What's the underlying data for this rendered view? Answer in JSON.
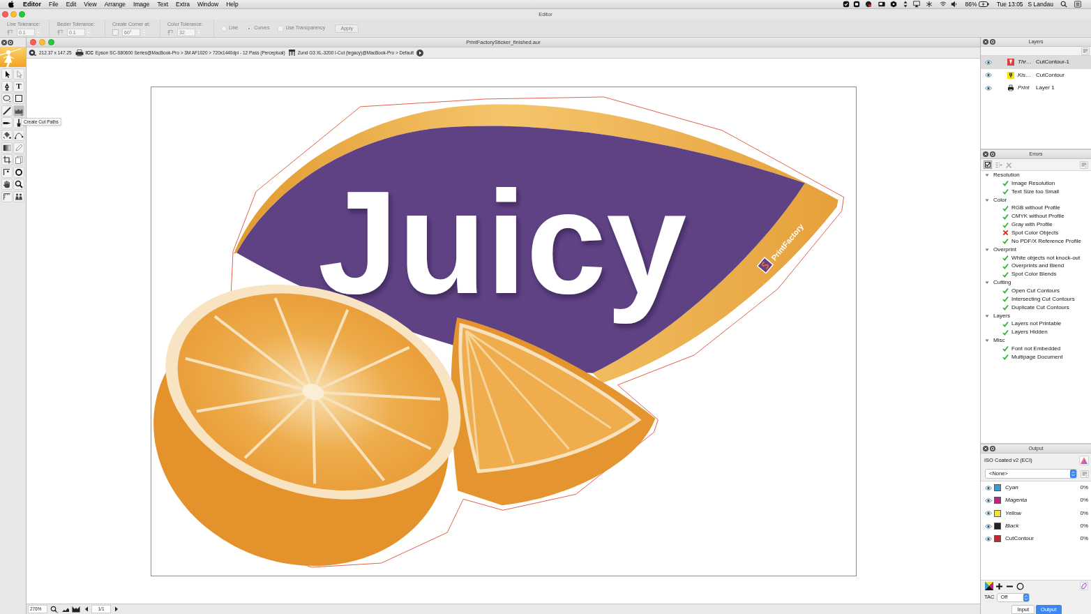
{
  "menubar": {
    "app": "Editor",
    "menus": [
      "File",
      "Edit",
      "View",
      "Arrange",
      "Image",
      "Text",
      "Extra",
      "Window",
      "Help"
    ],
    "battery": "86%",
    "clock": "Tue 13:05",
    "user": "S Landau"
  },
  "window": {
    "title": "Editor"
  },
  "toolbar": {
    "disabled": true,
    "fields": [
      {
        "label": "Line Tolerance:",
        "value": "0.1",
        "kind": "tolerance"
      },
      {
        "label": "Bezier Tolerance:",
        "value": "0.1",
        "kind": "tolerance"
      },
      {
        "label": "Create Corner at:",
        "value": "60°",
        "kind": "corner"
      },
      {
        "label": "Color Tolerance:",
        "value": "32",
        "kind": "tolerance"
      }
    ],
    "radios": [
      {
        "label": "Line",
        "selected": false
      },
      {
        "label": "Curves",
        "selected": true
      }
    ],
    "checkbox": {
      "label": "Use Trancparency",
      "checked": false
    },
    "apply": "Apply"
  },
  "toolbox": {
    "tools": [
      {
        "kind": "select",
        "selected": false
      },
      {
        "kind": "direct",
        "selected": false
      },
      {
        "kind": "pen",
        "selected": false
      },
      {
        "kind": "text",
        "glyph": "T",
        "selected": false
      },
      {
        "kind": "ellipse",
        "selected": false
      },
      {
        "kind": "rectangle",
        "selected": false
      },
      {
        "kind": "line",
        "selected": false
      },
      {
        "kind": "cutpaths",
        "selected": true
      },
      {
        "kind": "knife",
        "selected": false
      },
      {
        "kind": "brush",
        "selected": false
      },
      {
        "kind": "bucket",
        "selected": false
      },
      {
        "kind": "curve",
        "selected": false
      },
      {
        "kind": "gradient",
        "selected": false
      },
      {
        "kind": "pencil",
        "selected": false
      },
      {
        "kind": "crop",
        "selected": false
      },
      {
        "kind": "pages",
        "selected": false
      },
      {
        "kind": "corner",
        "selected": false
      },
      {
        "kind": "target",
        "selected": false
      },
      {
        "kind": "hand",
        "selected": false
      },
      {
        "kind": "zoom",
        "selected": false
      },
      {
        "kind": "ruler",
        "selected": false
      },
      {
        "kind": "figures",
        "selected": false
      }
    ],
    "tooltip": "Create Cut Paths"
  },
  "document": {
    "title": "PrintFactorySticker_finished.aur",
    "size": "212.37 x 147.25",
    "icc": "ICC",
    "printer": "Epson SC-S80600 Series@MacBook-Pro > 3M AF1020 > 720x1440dpi - 12 Pass (Perceptual)",
    "cutter": "Zund G3 XL-3200 I-Cut (legacy)@MacBook-Pro > Default",
    "artwork": {
      "headline": "Juicy",
      "brand": "PrintFactory"
    }
  },
  "status_bar": {
    "zoom": "276%",
    "page": "1/1"
  },
  "layers_panel": {
    "title": "Layers",
    "layers": [
      {
        "mode": "Thr…",
        "name": "CutContour-1",
        "kind": "thru-cut",
        "visible": true,
        "selected": true
      },
      {
        "mode": "Kis…",
        "name": "CutContour",
        "kind": "kiss-cut",
        "visible": true,
        "selected": false
      },
      {
        "mode": "Print",
        "name": "Layer 1",
        "kind": "print",
        "visible": true,
        "selected": false
      }
    ]
  },
  "errors_panel": {
    "title": "Errors",
    "groups": [
      {
        "name": "Resolution",
        "expanded": true,
        "children": [
          {
            "name": "Image Resolution",
            "passed": true
          },
          {
            "name": "Text Size too Small",
            "passed": true
          }
        ]
      },
      {
        "name": "Color",
        "expanded": true,
        "children": [
          {
            "name": "RGB without Profile",
            "passed": true
          },
          {
            "name": "CMYK without Profile",
            "passed": true
          },
          {
            "name": "Gray with Profile",
            "passed": true
          },
          {
            "name": "Spot Color Objects",
            "passed": false
          },
          {
            "name": "No PDF/X Reference Profile",
            "passed": true
          }
        ]
      },
      {
        "name": "Overprint",
        "expanded": true,
        "children": [
          {
            "name": "White objects not knock-out",
            "passed": true
          },
          {
            "name": "Overprints and Blend",
            "passed": true
          },
          {
            "name": "Spot Color Blends",
            "passed": true
          }
        ]
      },
      {
        "name": "Cutting",
        "expanded": true,
        "children": [
          {
            "name": "Open Cut Contours",
            "passed": true
          },
          {
            "name": "Intersecting Cut Contours",
            "passed": true
          },
          {
            "name": "Duplicate Cut Contours",
            "passed": true
          }
        ]
      },
      {
        "name": "Layers",
        "expanded": true,
        "children": [
          {
            "name": "Layers not Printable",
            "passed": true
          },
          {
            "name": "Layers Hidden",
            "passed": true
          }
        ]
      },
      {
        "name": "Misc",
        "expanded": true,
        "children": [
          {
            "name": "Font not Embedded",
            "passed": true
          },
          {
            "name": "Multipage Document",
            "passed": true
          }
        ]
      }
    ]
  },
  "output_panel": {
    "title": "Output",
    "profile": "ISO Coated v2 (ECI)",
    "select": "<None>",
    "channels": [
      {
        "name": "Cyan",
        "kind": "process",
        "color": "#3a9bd0",
        "percent": "0%",
        "visible": true
      },
      {
        "name": "Magenta",
        "kind": "process",
        "color": "#c0257e",
        "percent": "0%",
        "visible": true
      },
      {
        "name": "Yellow",
        "kind": "process",
        "color": "#f1e23a",
        "percent": "0%",
        "visible": true
      },
      {
        "name": "Black",
        "kind": "process",
        "color": "#232323",
        "percent": "0%",
        "visible": true
      },
      {
        "name": "CutContour",
        "kind": "spot",
        "color": "#c4282c",
        "percent": "0%",
        "visible": true
      }
    ],
    "tac_label": "TAC",
    "tac": "Off",
    "tabs": [
      {
        "label": "Input",
        "selected": false
      },
      {
        "label": "Output",
        "selected": true
      }
    ]
  }
}
